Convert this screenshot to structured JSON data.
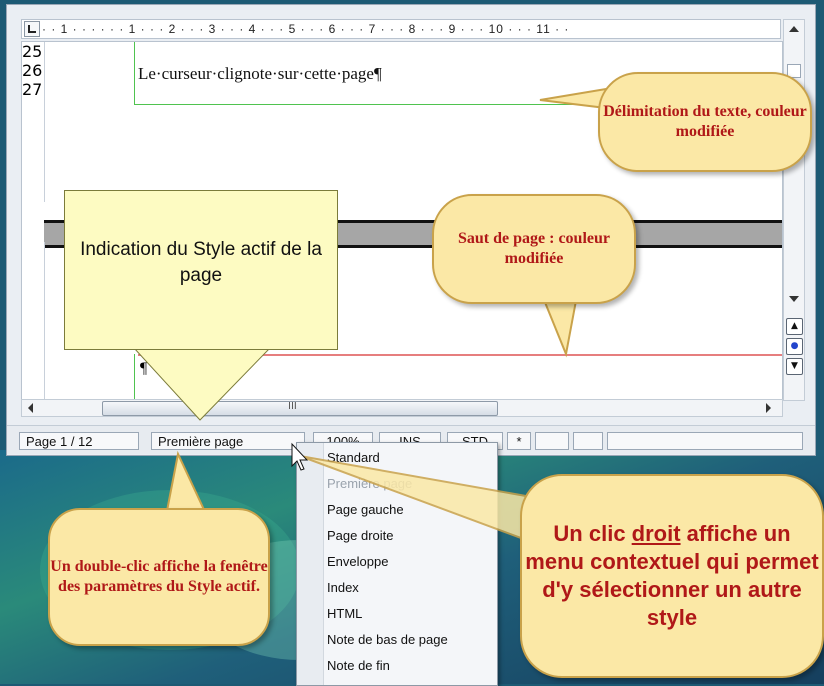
{
  "ruler": {
    "h_ticks": "· · 1 · · ·  · · · 1 · · · 2 · · · 3 · · · 4 · · · 5 · · · 6 · · · 7 · · · 8 · · · 9 · · · 10 · · · 11 · ·",
    "v_ticks": [
      "25",
      "26",
      "27"
    ]
  },
  "document": {
    "line_text": "Le·curseur·clignote·sur·cette·page¶",
    "para_mark": "¶"
  },
  "scrollbar": {
    "thumb_grip": "III",
    "btn_prev": "▲",
    "btn_nav": "●",
    "btn_next": "▼"
  },
  "statusbar": {
    "page": "Page 1 / 12",
    "style": "Première page",
    "zoom": "100%",
    "insert_mode": "INS",
    "selection_mode": "STD",
    "modified": "*"
  },
  "context_menu": {
    "items": [
      {
        "label": "Standard",
        "enabled": true
      },
      {
        "label": "Première page",
        "enabled": false
      },
      {
        "label": "Page gauche",
        "enabled": true
      },
      {
        "label": "Page droite",
        "enabled": true
      },
      {
        "label": "Enveloppe",
        "enabled": true
      },
      {
        "label": "Index",
        "enabled": true
      },
      {
        "label": "HTML",
        "enabled": true
      },
      {
        "label": "Note de bas de page",
        "enabled": true
      },
      {
        "label": "Note de fin",
        "enabled": true
      }
    ]
  },
  "callouts": {
    "delimitation": "Délimitation du texte, couleur modifiée",
    "saut": "Saut de page : couleur modifiée",
    "style_indication": "Indication du Style actif de la page",
    "double_clic": "Un double-clic affiche la fenêtre des paramètres du Style actif.",
    "clic_droit_a": "Un clic ",
    "clic_droit_u": "droit",
    "clic_droit_b": " affiche un menu contextuel qui permet d'y sélectionner un autre style"
  },
  "colors": {
    "text_boundary": "#4fc34f",
    "page_break": "#e67e7e",
    "callout_text": "#b01818",
    "callout_fill": "#fbe8a6"
  }
}
